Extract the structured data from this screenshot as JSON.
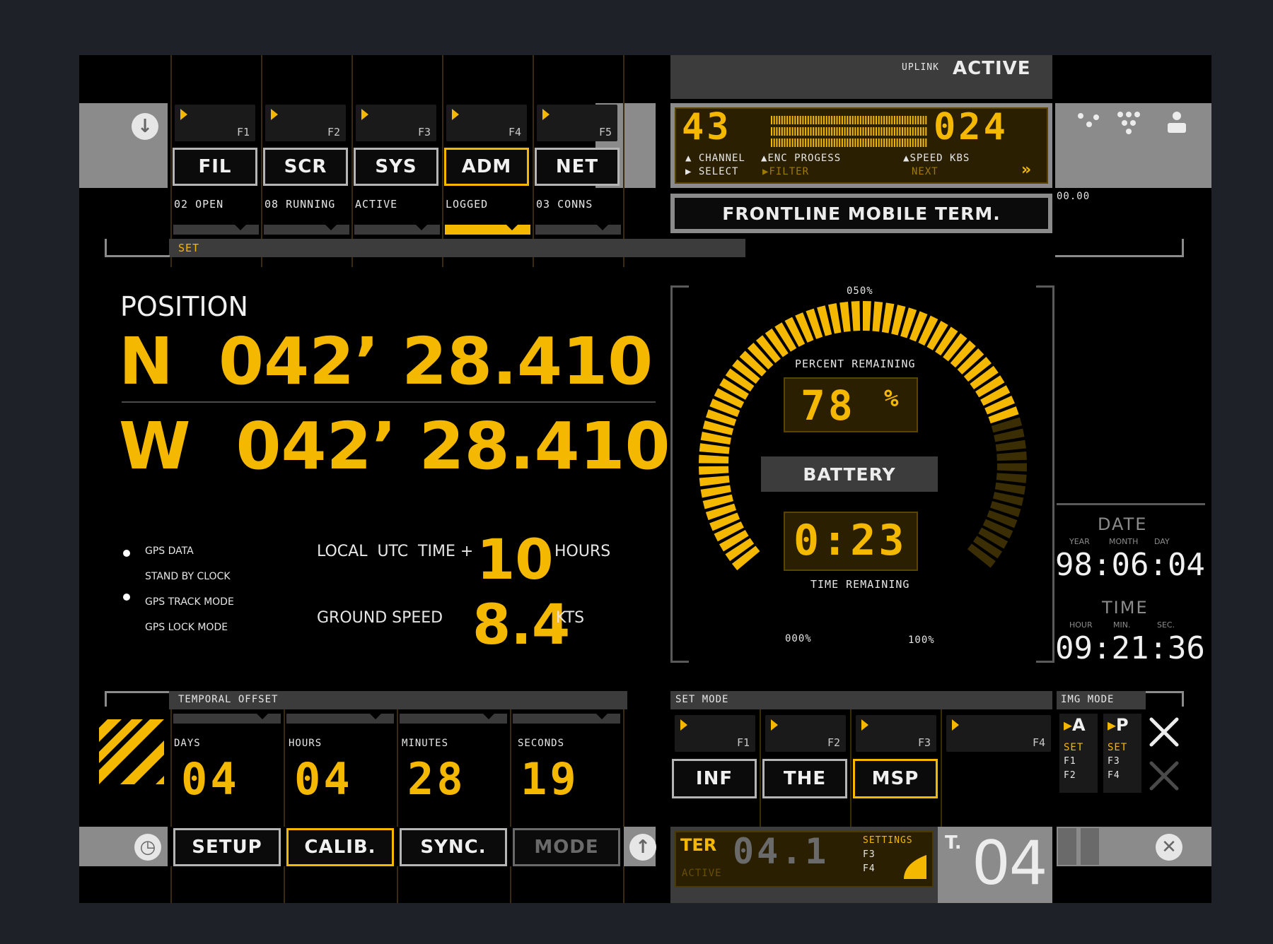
{
  "top": {
    "uplink_label": "UPLINK",
    "uplink_status": "ACTIVE",
    "fkeys": [
      "F1",
      "F2",
      "F3",
      "F4",
      "F5"
    ],
    "buttons": [
      {
        "label": "FIL",
        "status": "02 OPEN"
      },
      {
        "label": "SCR",
        "status": "08 RUNNING"
      },
      {
        "label": "SYS",
        "status": "ACTIVE"
      },
      {
        "label": "ADM",
        "status": "LOGGED"
      },
      {
        "label": "NET",
        "status": "03 CONNS"
      }
    ],
    "active_button": "ADM",
    "set_label": "SET"
  },
  "readout": {
    "channel_value": "43",
    "enc_value": "024",
    "channel_label": "CHANNEL",
    "enc_label": "ENC PROGESS",
    "speed_label": "SPEED KBS",
    "select_label": "SELECT",
    "filter_label": "FILTER",
    "next_label": "NEXT",
    "arrow_label": "»",
    "enc_progress": 1.0
  },
  "terminal_title": "FRONTLINE MOBILE TERM.",
  "side_code": "00.00",
  "position": {
    "title": "POSITION",
    "north": "N  042’ 28.410",
    "west": "W  042’ 28.410"
  },
  "gps_modes": [
    {
      "label": "GPS DATA",
      "active": true
    },
    {
      "label": "STAND BY CLOCK",
      "active": false
    },
    {
      "label": "GPS TRACK MODE",
      "active": true
    },
    {
      "label": "GPS LOCK MODE",
      "active": false
    }
  ],
  "utc": {
    "label": "LOCAL  UTC  TIME +",
    "value": "10",
    "unit": "HOURS"
  },
  "ground_speed": {
    "label": "GROUND SPEED",
    "value": "8.4",
    "unit": "KTS"
  },
  "battery": {
    "top_label": "050%",
    "min_label": "000%",
    "max_label": "100%",
    "percent_label": "PERCENT REMAINING",
    "percent_value": "78",
    "percent_sign": "%",
    "title": "BATTERY",
    "time_value": "0:23",
    "time_label": "TIME REMAINING",
    "level": 0.78
  },
  "date": {
    "title": "DATE",
    "sub": [
      "YEAR",
      "MONTH",
      "DAY"
    ],
    "value": "98:06:04"
  },
  "time": {
    "title": "TIME",
    "sub": [
      "HOUR",
      "MIN.",
      "SEC."
    ],
    "value": "09:21:36"
  },
  "temporal": {
    "title": "TEMPORAL OFFSET",
    "fields": [
      {
        "label": "DAYS",
        "value": "04"
      },
      {
        "label": "HOURS",
        "value": "04"
      },
      {
        "label": "MINUTES",
        "value": "28"
      },
      {
        "label": "SECONDS",
        "value": "19"
      }
    ]
  },
  "bottom_buttons": [
    {
      "label": "SETUP",
      "state": "normal"
    },
    {
      "label": "CALIB.",
      "state": "active"
    },
    {
      "label": "SYNC.",
      "state": "normal"
    },
    {
      "label": "MODE",
      "state": "dim"
    }
  ],
  "set_mode": {
    "title": "SET MODE",
    "fkeys": [
      "F1",
      "F2",
      "F3",
      "F4"
    ],
    "buttons": [
      "INF",
      "THE",
      "MSP"
    ],
    "active": "MSP"
  },
  "img_mode": {
    "title": "IMG MODE",
    "a_label": "A",
    "p_label": "P",
    "set_label": "SET",
    "a_keys": [
      "F1",
      "F2"
    ],
    "p_keys": [
      "F3",
      "F4"
    ]
  },
  "ter": {
    "label": "TER",
    "value": "04.1",
    "status": "ACTIVE",
    "settings_label": "SETTINGS",
    "keys": [
      "F3",
      "F4"
    ]
  },
  "t_block": {
    "label": "T.",
    "value": "04"
  },
  "colors": {
    "accent": "#f5b800",
    "panel_gray": "#8b8b8b",
    "background": "#000000",
    "page": "#1e2127"
  }
}
